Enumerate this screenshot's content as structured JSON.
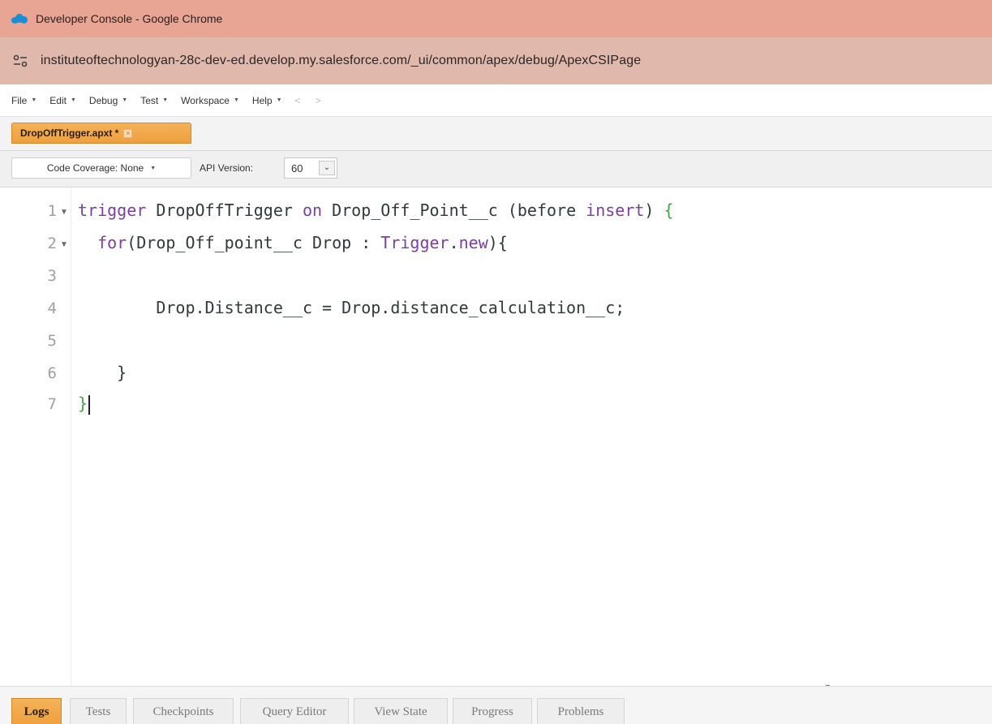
{
  "window": {
    "title": "Developer Console - Google Chrome",
    "url": "instituteoftechnologyan-28c-dev-ed.develop.my.salesforce.com/_ui/common/apex/debug/ApexCSIPage"
  },
  "menu": {
    "items": [
      "File",
      "Edit",
      "Debug",
      "Test",
      "Workspace",
      "Help"
    ],
    "back": "<",
    "forward": ">"
  },
  "file_tab": {
    "name": "DropOffTrigger.apxt *",
    "close": "×"
  },
  "toolbar": {
    "coverage": "Code Coverage: None",
    "api_label": "API Version:",
    "api_value": "60"
  },
  "editor": {
    "line_numbers": [
      "1",
      "2",
      "3",
      "4",
      "5",
      "6",
      "7"
    ],
    "lines": [
      {
        "t1": "trigger",
        "t2": " DropOffTrigger ",
        "t3": "on",
        "t4": " Drop_Off_Point__c (before ",
        "t5": "insert",
        "t6": ") ",
        "t7": "{"
      },
      {
        "t1": "  for",
        "t2": "(Drop_Off_point__c Drop : ",
        "t3": "Trigger",
        "t4": ".",
        "t5": "new",
        "t6": "){"
      },
      {
        "text": ""
      },
      {
        "text": "        Drop.Distance__c = Drop.distance_calculation__c;"
      },
      {
        "text": ""
      },
      {
        "text": "    }"
      },
      {
        "text": "}"
      }
    ]
  },
  "bottom_tabs": [
    "Logs",
    "Tests",
    "Checkpoints",
    "Query Editor",
    "View State",
    "Progress",
    "Problems"
  ]
}
